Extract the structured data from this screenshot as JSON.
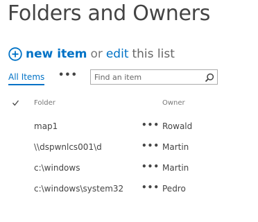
{
  "page": {
    "title": "Folders and Owners"
  },
  "actions": {
    "new_item": "new item",
    "or": "or",
    "edit": "edit",
    "this_list": "this list"
  },
  "view": {
    "current": "All Items",
    "more": "•••",
    "search_placeholder": "Find an item"
  },
  "list": {
    "columns": {
      "folder": "Folder",
      "owner": "Owner"
    },
    "item_menu": "•••",
    "rows": [
      {
        "folder": "map1",
        "owner": "Rowald"
      },
      {
        "folder": "\\\\dspwnlcs001\\d",
        "owner": "Martin"
      },
      {
        "folder": "c:\\windows",
        "owner": "Martin"
      },
      {
        "folder": "c:\\windows\\system32",
        "owner": "Pedro"
      }
    ]
  },
  "colors": {
    "accent": "#0072c6",
    "text": "#444444",
    "muted": "#777777"
  },
  "icons": [
    "plus-circle-icon",
    "search-icon",
    "checkmark-icon"
  ]
}
